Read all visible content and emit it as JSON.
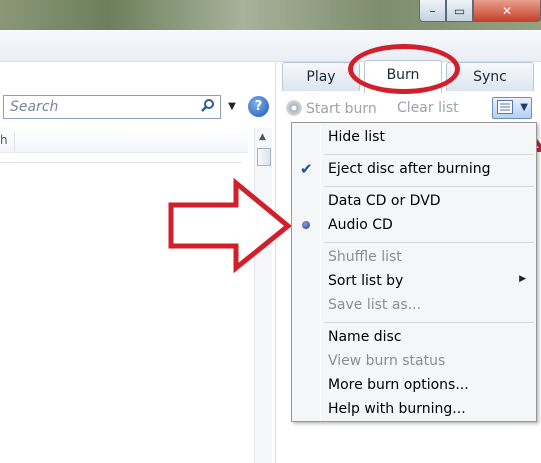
{
  "window": {
    "controls": {
      "minimize": "–",
      "maximize": "▭",
      "close": "✕"
    }
  },
  "library": {
    "search": {
      "placeholder": "Search"
    },
    "column_header_text": "h"
  },
  "tabs": [
    {
      "label": "Play"
    },
    {
      "label": "Burn"
    },
    {
      "label": "Sync"
    }
  ],
  "burn_toolbar": {
    "start_burn": "Start burn",
    "clear_list": "Clear list"
  },
  "menu": {
    "hide_list": "Hide list",
    "eject_disc": "Eject disc after burning",
    "data_cd": "Data CD or DVD",
    "audio_cd": "Audio CD",
    "shuffle_list": "Shuffle list",
    "sort_list_by": "Sort list by",
    "save_list_as": "Save list as...",
    "name_disc": "Name disc",
    "view_burn_status": "View burn status",
    "more_burn_options": "More burn options...",
    "help_with_burning": "Help with burning..."
  },
  "icons": {
    "search": "search-icon",
    "help": "help-icon",
    "list_options": "list-options-icon",
    "disc": "disc-icon"
  },
  "colors": {
    "annotation_red": "#d11f2b",
    "menu_background": "#f5f6f7",
    "disabled_text": "#8d8d8d"
  },
  "state": {
    "active_tab": "Burn",
    "checked_items": [
      "Eject disc after burning"
    ],
    "selected_disc_type": "Audio CD"
  }
}
